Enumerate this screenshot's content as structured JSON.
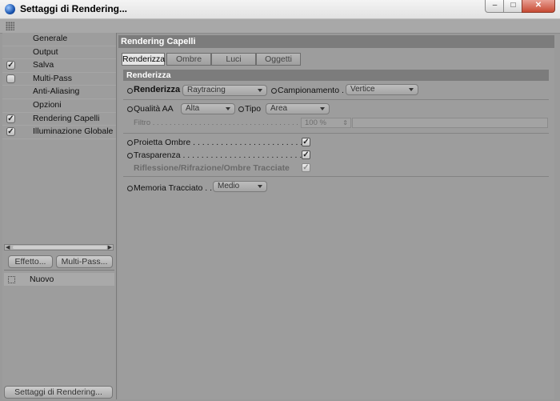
{
  "window": {
    "title": "Settaggi di Rendering...",
    "min_glyph": "0",
    "max_glyph": "1",
    "close_glyph": "r"
  },
  "sidebar": {
    "items": [
      {
        "label": "Generale",
        "checked": null
      },
      {
        "label": "Output",
        "checked": null
      },
      {
        "label": "Salva",
        "checked": true
      },
      {
        "label": "Multi-Pass",
        "checked": false
      },
      {
        "label": "Anti-Aliasing",
        "checked": null
      },
      {
        "label": "Opzioni",
        "checked": null
      },
      {
        "label": "Rendering Capelli",
        "checked": true
      },
      {
        "label": "Illuminazione Globale",
        "checked": true
      }
    ],
    "check_glyph": "✓",
    "effetto_label": "Effetto...",
    "multipass_label": "Multi-Pass...",
    "preset_label": "Nuovo",
    "settings_button_label": "Settaggi di Rendering..."
  },
  "main": {
    "header": "Rendering Capelli",
    "tabs": [
      "Renderizza",
      "Ombre",
      "Luci",
      "Oggetti"
    ],
    "active_tab": "Renderizza",
    "section_title": "Renderizza",
    "renderizza_label": "Renderizza",
    "renderizza_value": "Raytracing",
    "campionamento_label": "Campionamento . .",
    "campionamento_value": "Vertice",
    "qualita_label": "Qualità AA",
    "qualita_value": "Alta",
    "tipo_label": "Tipo",
    "tipo_value": "Area",
    "filtro_label": "Filtro . . . . . . . . . . . . . . . . . . . . . . . . . . . . . . . . . . . . . . . . . . . . .",
    "filtro_value": "100 %",
    "proietta_label": "Proietta Ombre . . . . . . . . . . . . . . . . . . . . . . . . . . . . . .",
    "proietta_checked": true,
    "trasparenza_label": "Trasparenza . . . . . . . . . . . . . . . . . . . . . . . . . . . . . . . .",
    "trasparenza_checked": true,
    "riflessione_label": "Riflessione/Rifrazione/Ombre Tracciate",
    "riflessione_checked": true,
    "memoria_label": "Memoria Tracciato . . .",
    "memoria_value": "Medio",
    "check_glyph": "✓"
  },
  "colors": {
    "background": "#9d9d9d",
    "header": "#7c7c7c",
    "active_tab": "#e6e6e6",
    "close_button": "#c74a33"
  }
}
